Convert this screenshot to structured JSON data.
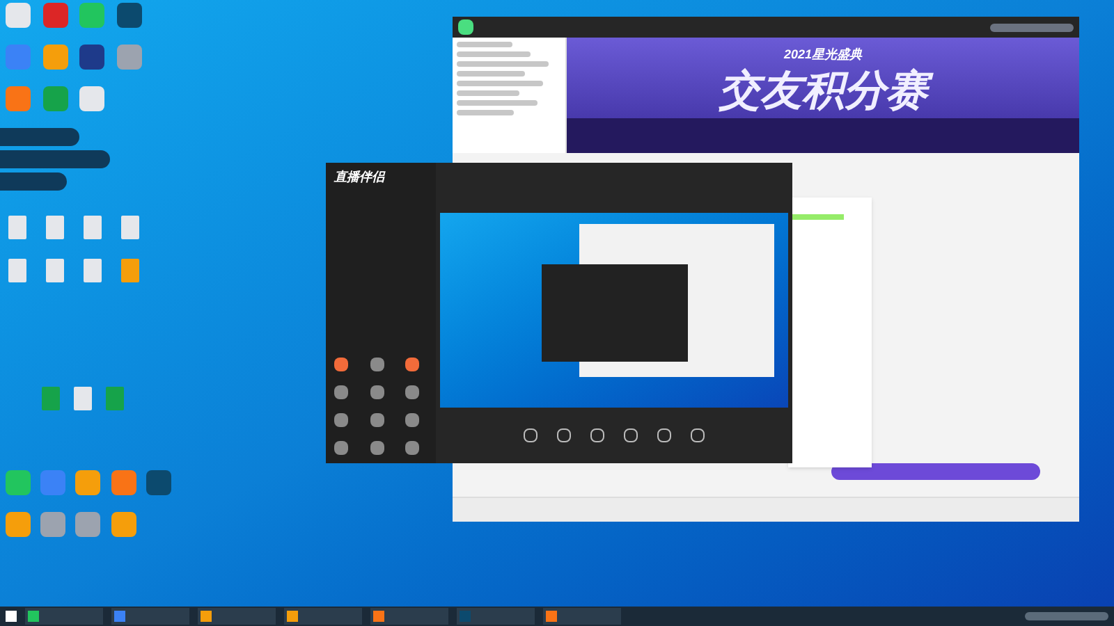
{
  "banner": {
    "subtitle": "2021星光盛典",
    "title": "交友积分赛"
  },
  "streaming_app": {
    "logo_text": "直播伴侣"
  }
}
